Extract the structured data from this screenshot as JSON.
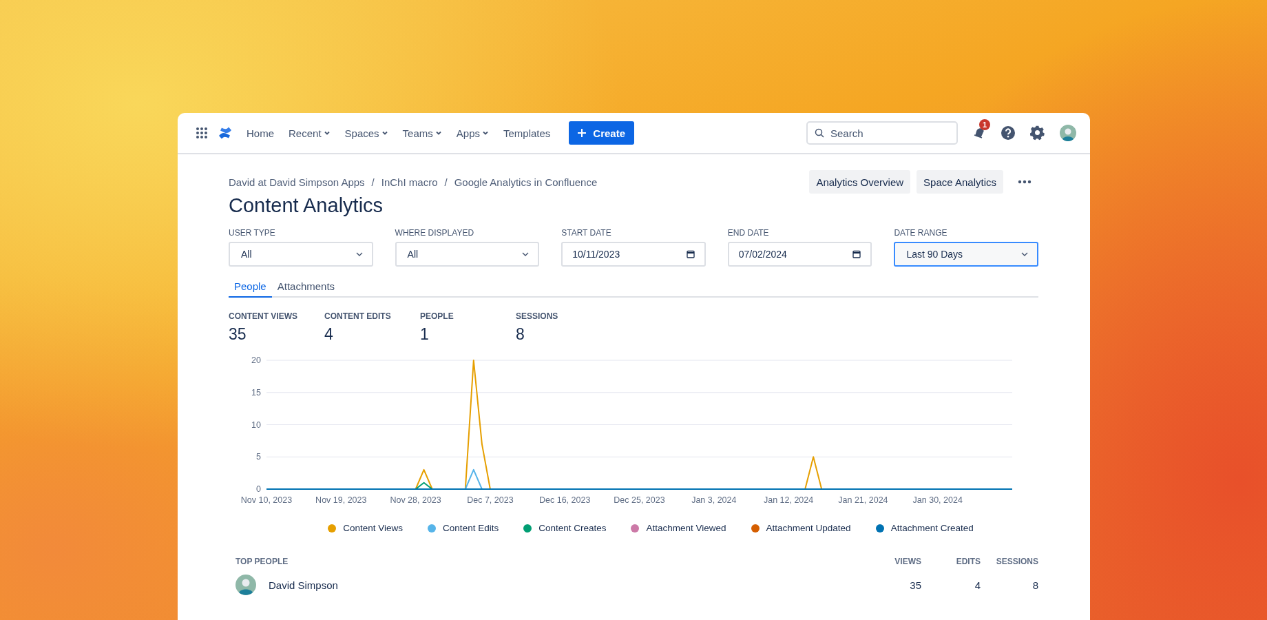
{
  "nav": {
    "items": [
      {
        "label": "Home",
        "dropdown": false
      },
      {
        "label": "Recent",
        "dropdown": true
      },
      {
        "label": "Spaces",
        "dropdown": true
      },
      {
        "label": "Teams",
        "dropdown": true
      },
      {
        "label": "Apps",
        "dropdown": true
      },
      {
        "label": "Templates",
        "dropdown": false
      }
    ],
    "create_button": "Create",
    "search": {
      "placeholder": "Search"
    },
    "notifications": "1"
  },
  "breadcrumbs": {
    "separator": "/",
    "items": [
      "David at David Simpson Apps",
      "InChI macro",
      "Google Analytics in Confluence"
    ]
  },
  "header_buttons": [
    "Analytics Overview",
    "Space Analytics"
  ],
  "title": "Content Analytics",
  "filters": [
    {
      "label": "USER TYPE",
      "kind": "select",
      "value": "All",
      "focused": false
    },
    {
      "label": "WHERE DISPLAYED",
      "kind": "select",
      "value": "All",
      "focused": false
    },
    {
      "label": "START DATE",
      "kind": "date",
      "value": "10/11/2023",
      "focused": false
    },
    {
      "label": "END DATE",
      "kind": "date",
      "value": "07/02/2024",
      "focused": false
    },
    {
      "label": "DATE RANGE",
      "kind": "select",
      "value": "Last 90 Days",
      "focused": true
    }
  ],
  "tabs": [
    {
      "label": "People",
      "selected": true
    },
    {
      "label": "Attachments",
      "selected": false
    }
  ],
  "stats": [
    {
      "label": "CONTENT VIEWS",
      "value": "35"
    },
    {
      "label": "CONTENT EDITS",
      "value": "4"
    },
    {
      "label": "PEOPLE",
      "value": "1"
    },
    {
      "label": "SESSIONS",
      "value": "8"
    }
  ],
  "chart_data": {
    "type": "line",
    "ylim": [
      0,
      20
    ],
    "grid": true,
    "legend": true,
    "categories": [
      "Nov 10, 2023",
      null,
      null,
      null,
      null,
      null,
      null,
      null,
      null,
      "Nov 19, 2023",
      null,
      null,
      null,
      null,
      null,
      null,
      null,
      null,
      "Nov 28, 2023",
      null,
      null,
      null,
      null,
      null,
      null,
      null,
      null,
      "Dec 7, 2023",
      null,
      null,
      null,
      null,
      null,
      null,
      null,
      null,
      "Dec 16, 2023",
      null,
      null,
      null,
      null,
      null,
      null,
      null,
      null,
      "Dec 25, 2023",
      null,
      null,
      null,
      null,
      null,
      null,
      null,
      null,
      "Jan 3, 2024",
      null,
      null,
      null,
      null,
      null,
      null,
      null,
      null,
      "Jan 12, 2024",
      null,
      null,
      null,
      null,
      null,
      null,
      null,
      null,
      "Jan 21, 2024",
      null,
      null,
      null,
      null,
      null,
      null,
      null,
      null,
      "Jan 30, 2024",
      null,
      null,
      null,
      null,
      null,
      null,
      null,
      null,
      null
    ],
    "yticks": [
      0,
      5,
      10,
      15,
      20
    ],
    "series": [
      {
        "name": "Content Views",
        "color": "#e69f00",
        "values": [
          null,
          null,
          null,
          null,
          null,
          null,
          null,
          null,
          null,
          null,
          null,
          null,
          null,
          null,
          null,
          null,
          null,
          null,
          0,
          3,
          0,
          null,
          null,
          null,
          0,
          20,
          7,
          0,
          null,
          null,
          null,
          null,
          null,
          null,
          null,
          null,
          null,
          null,
          null,
          null,
          null,
          null,
          null,
          null,
          null,
          null,
          null,
          null,
          null,
          null,
          null,
          null,
          null,
          null,
          null,
          null,
          null,
          null,
          null,
          null,
          null,
          null,
          null,
          null,
          null,
          0,
          5,
          0,
          null,
          null,
          null,
          null,
          null,
          null,
          null,
          null,
          null,
          null,
          null,
          null,
          null,
          null,
          null,
          null,
          null,
          null,
          null,
          null,
          null,
          null,
          null
        ]
      },
      {
        "name": "Content Edits",
        "color": "#56b4e9",
        "values": [
          null,
          null,
          null,
          null,
          null,
          null,
          null,
          null,
          null,
          null,
          null,
          null,
          null,
          null,
          null,
          null,
          null,
          null,
          null,
          null,
          null,
          null,
          null,
          null,
          0,
          3,
          0,
          null,
          null,
          null,
          null,
          null,
          null,
          null,
          null,
          null,
          null,
          null,
          null,
          null,
          null,
          null,
          null,
          null,
          null,
          null,
          null,
          null,
          null,
          null,
          null,
          null,
          null,
          null,
          null,
          null,
          null,
          null,
          null,
          null,
          null,
          null,
          null,
          null,
          null,
          null,
          null,
          null,
          null,
          null,
          null,
          null,
          null,
          null,
          null,
          null,
          null,
          null,
          null,
          null,
          null,
          null,
          null,
          null,
          null,
          null,
          null,
          null,
          null,
          null,
          null
        ]
      },
      {
        "name": "Content Creates",
        "color": "#009e73",
        "values": [
          null,
          null,
          null,
          null,
          null,
          null,
          null,
          null,
          null,
          null,
          null,
          null,
          null,
          null,
          null,
          null,
          null,
          null,
          0,
          1,
          0,
          null,
          null,
          null,
          null,
          null,
          null,
          null,
          null,
          null,
          null,
          null,
          null,
          null,
          null,
          null,
          null,
          null,
          null,
          null,
          null,
          null,
          null,
          null,
          null,
          null,
          null,
          null,
          null,
          null,
          null,
          null,
          null,
          null,
          null,
          null,
          null,
          null,
          null,
          null,
          null,
          null,
          null,
          null,
          null,
          null,
          null,
          null,
          null,
          null,
          null,
          null,
          null,
          null,
          null,
          null,
          null,
          null,
          null,
          null,
          null,
          null,
          null,
          null,
          null,
          null,
          null,
          null,
          null,
          null,
          null
        ]
      },
      {
        "name": "Attachment Viewed",
        "color": "#cc79a7",
        "values": [
          null,
          null,
          null,
          null,
          null,
          null,
          null,
          null,
          null,
          null,
          null,
          null,
          null,
          null,
          null,
          null,
          null,
          null,
          null,
          null,
          null,
          null,
          null,
          null,
          null,
          null,
          null,
          null,
          null,
          null,
          null,
          null,
          null,
          null,
          null,
          null,
          null,
          null,
          null,
          null,
          null,
          null,
          null,
          null,
          null,
          null,
          null,
          null,
          null,
          null,
          null,
          null,
          null,
          null,
          null,
          null,
          null,
          null,
          null,
          null,
          null,
          null,
          null,
          null,
          null,
          null,
          null,
          null,
          null,
          null,
          null,
          null,
          null,
          null,
          null,
          null,
          null,
          null,
          null,
          null,
          null,
          null,
          null,
          null,
          null,
          null,
          null,
          null,
          null,
          null,
          null
        ]
      },
      {
        "name": "Attachment Updated",
        "color": "#d55e00",
        "values": [
          null,
          null,
          null,
          null,
          null,
          null,
          null,
          null,
          null,
          null,
          null,
          null,
          null,
          null,
          null,
          null,
          null,
          null,
          null,
          null,
          null,
          null,
          null,
          null,
          null,
          null,
          null,
          null,
          null,
          null,
          null,
          null,
          null,
          null,
          null,
          null,
          null,
          null,
          null,
          null,
          null,
          null,
          null,
          null,
          null,
          null,
          null,
          null,
          null,
          null,
          null,
          null,
          null,
          null,
          null,
          null,
          null,
          null,
          null,
          null,
          null,
          null,
          null,
          null,
          null,
          null,
          null,
          null,
          null,
          null,
          null,
          null,
          null,
          null,
          null,
          null,
          null,
          null,
          null,
          null,
          null,
          null,
          null,
          null,
          null,
          null,
          null,
          null,
          null,
          null,
          null
        ]
      },
      {
        "name": "Attachment Created",
        "color": "#0072b2",
        "values": [
          0,
          0,
          0,
          0,
          0,
          0,
          0,
          0,
          0,
          0,
          0,
          0,
          0,
          0,
          0,
          0,
          0,
          0,
          0,
          0,
          0,
          0,
          0,
          0,
          0,
          0,
          0,
          0,
          0,
          0,
          0,
          0,
          0,
          0,
          0,
          0,
          0,
          0,
          0,
          0,
          0,
          0,
          0,
          0,
          0,
          0,
          0,
          0,
          0,
          0,
          0,
          0,
          0,
          0,
          0,
          0,
          0,
          0,
          0,
          0,
          0,
          0,
          0,
          0,
          0,
          0,
          0,
          0,
          0,
          0,
          0,
          0,
          0,
          0,
          0,
          0,
          0,
          0,
          0,
          0,
          0,
          0,
          0,
          0,
          0,
          0,
          0,
          0,
          0,
          0,
          0
        ]
      }
    ]
  },
  "top_people": {
    "columns": [
      "TOP PEOPLE",
      "VIEWS",
      "EDITS",
      "SESSIONS"
    ],
    "rows": [
      {
        "name": "David Simpson",
        "views": "35",
        "edits": "4",
        "sessions": "8"
      }
    ]
  }
}
